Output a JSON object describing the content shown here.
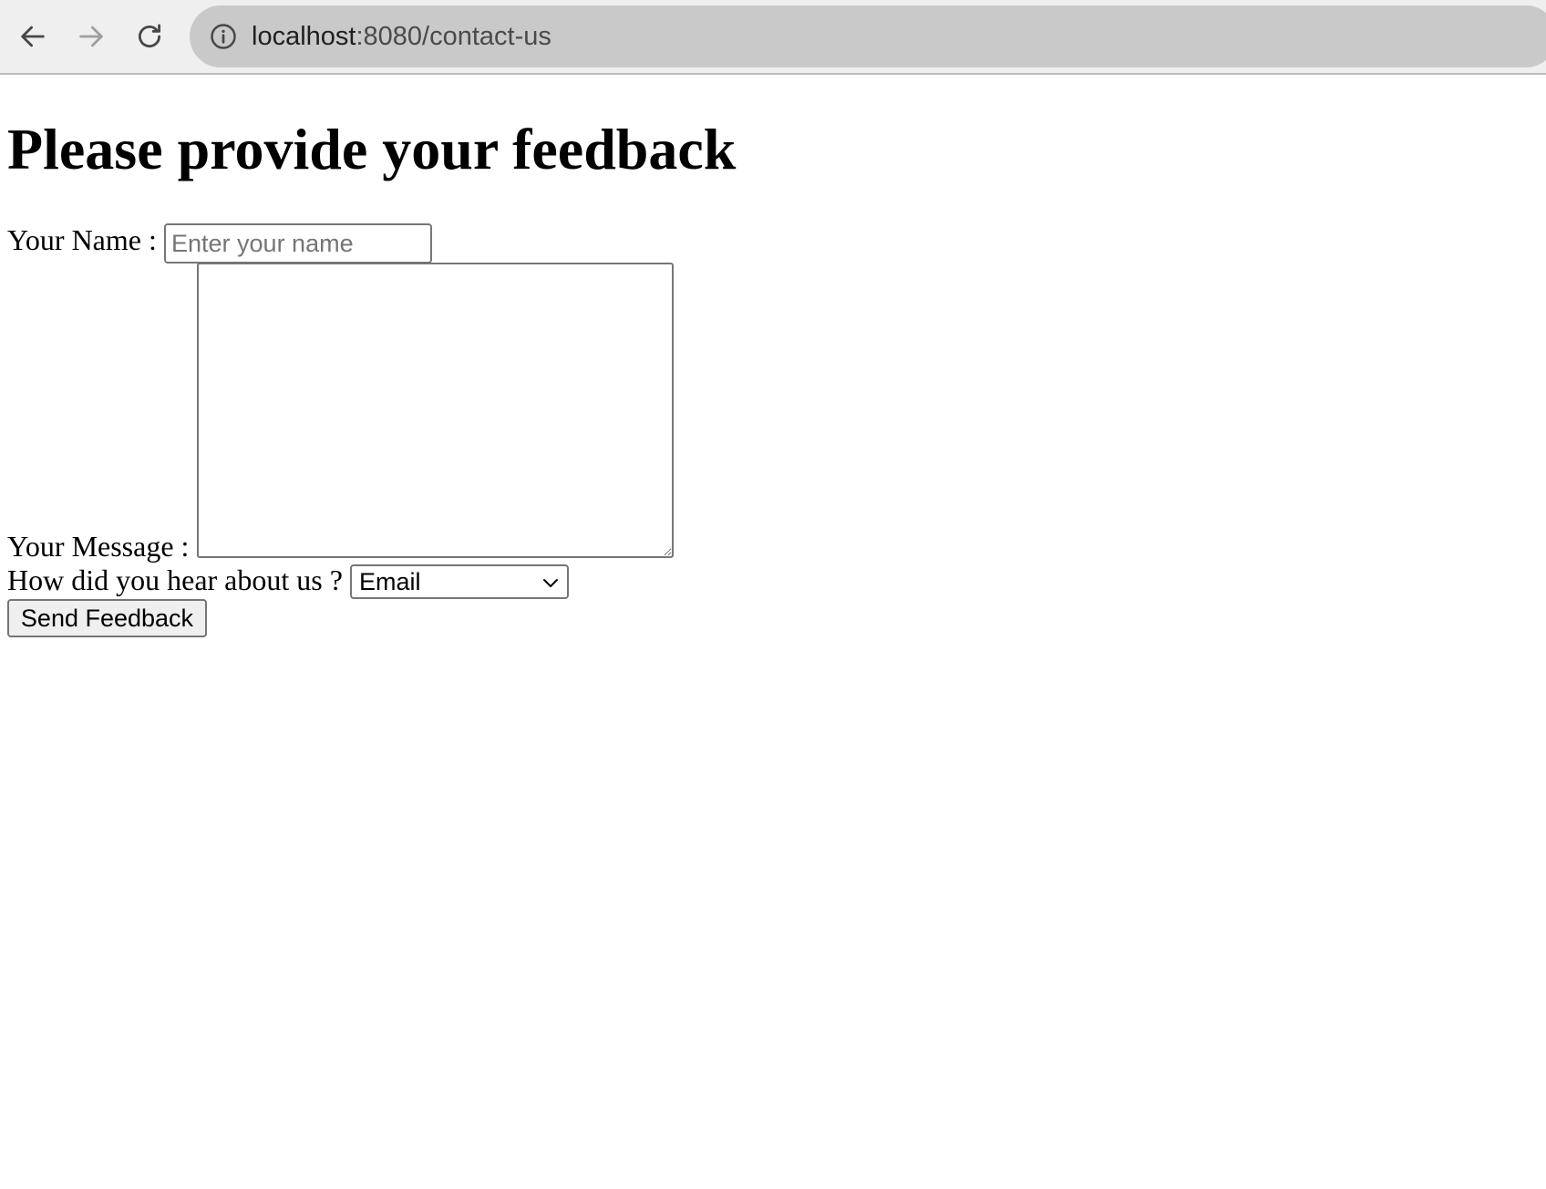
{
  "browser": {
    "url_host": "localhost",
    "url_rest": ":8080/contact-us"
  },
  "page": {
    "heading": "Please provide your feedback",
    "form": {
      "name_label": "Your Name :",
      "name_placeholder": "Enter your name",
      "name_value": "",
      "message_label": "Your Message :",
      "message_value": "",
      "source_label": "How did you hear about us ?",
      "source_selected": "Email",
      "submit_label": "Send Feedback"
    }
  },
  "icons": {
    "back": "arrow-left-icon",
    "forward": "arrow-right-icon",
    "reload": "reload-icon",
    "site_info": "info-icon",
    "dropdown": "chevron-down-icon"
  },
  "colors": {
    "toolbar": "#efefef",
    "address_bar": "#c9c9c9",
    "control_border": "#767676",
    "button_face": "#efefef",
    "forward_disabled": "#9e9e9e"
  }
}
